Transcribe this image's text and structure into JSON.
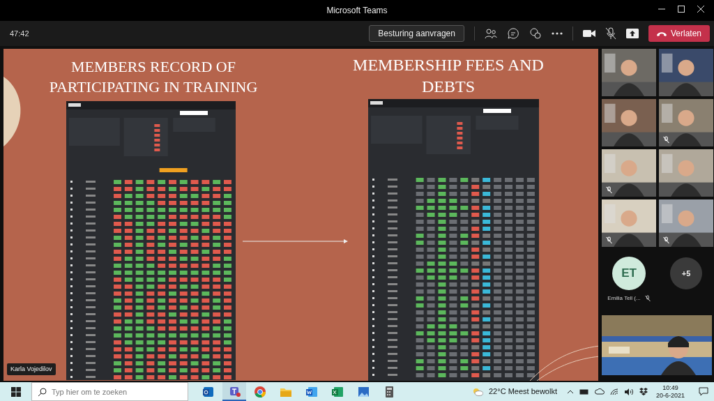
{
  "window": {
    "title": "Microsoft Teams"
  },
  "meeting_bar": {
    "timer": "47:42",
    "control_button": "Besturing aanvragen",
    "leave_button": "Verlaten"
  },
  "slide": {
    "titles": [
      "MEMBERS RECORD OF PARTICIPATING IN TRAINING",
      "MEMBERSHIP FEES AND DEBTS"
    ]
  },
  "presenter_label": "Karla Vojedilov",
  "video_tiles": [
    {
      "muted": false
    },
    {
      "muted": false
    },
    {
      "muted": false
    },
    {
      "muted": true
    },
    {
      "muted": true
    },
    {
      "muted": false
    },
    {
      "muted": true
    },
    {
      "muted": true
    }
  ],
  "participants": [
    {
      "kind": "avatar",
      "initials": "ET",
      "name": "Emilia Tell (...",
      "muted": true
    },
    {
      "kind": "overflow",
      "count": "+5"
    }
  ],
  "taskbar": {
    "search_placeholder": "Typ hier om te zoeken",
    "apps": [
      {
        "kind": "outlook",
        "selected": false
      },
      {
        "kind": "teams",
        "selected": true
      },
      {
        "kind": "chrome",
        "selected": false
      },
      {
        "kind": "files",
        "selected": false
      },
      {
        "kind": "word",
        "selected": false
      },
      {
        "kind": "excel",
        "selected": false
      },
      {
        "kind": "photos",
        "selected": false
      },
      {
        "kind": "calculator",
        "selected": false
      }
    ],
    "weather": "22°C Meest bewolkt",
    "time": "10:49",
    "date": "20-6-2021"
  }
}
